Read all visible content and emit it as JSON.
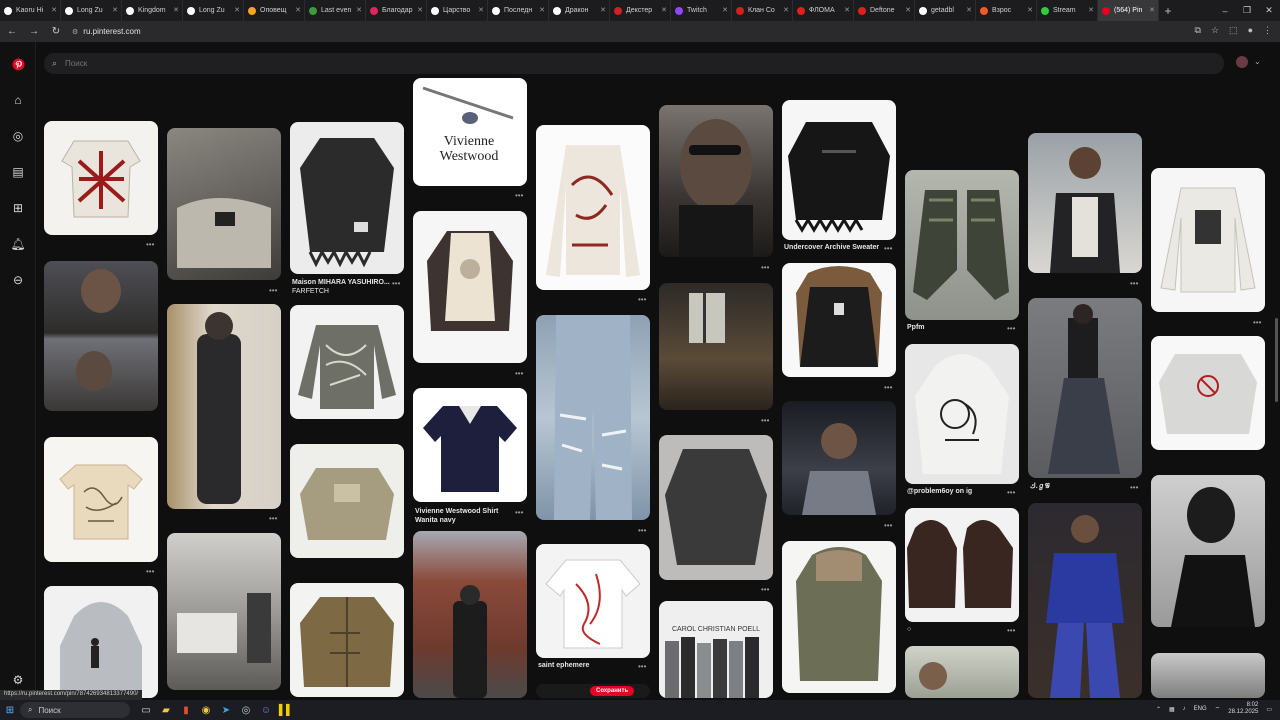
{
  "browser": {
    "tabs": [
      {
        "label": "Kaoru Hi",
        "color": "#ffffff"
      },
      {
        "label": "Long Zu",
        "color": "#ffffff"
      },
      {
        "label": "Kingdom",
        "color": "#ffffff"
      },
      {
        "label": "Long Zu",
        "color": "#ffffff"
      },
      {
        "label": "Оповещ",
        "color": "#f4a523"
      },
      {
        "label": "Last even",
        "color": "#3d9b3d"
      },
      {
        "label": "Благодар",
        "color": "#e0245e"
      },
      {
        "label": "Царство",
        "color": "#ffffff"
      },
      {
        "label": "Последн",
        "color": "#ffffff"
      },
      {
        "label": "Дракон",
        "color": "#ffffff"
      },
      {
        "label": "Декстер",
        "color": "#cc2222"
      },
      {
        "label": "Twitch",
        "color": "#9146ff"
      },
      {
        "label": "Клан Со",
        "color": "#cc2222"
      },
      {
        "label": "ФЛОМА",
        "color": "#e02020"
      },
      {
        "label": "Deftone",
        "color": "#e02020"
      },
      {
        "label": "getadbl",
        "color": "#ffffff"
      },
      {
        "label": "Взрос",
        "color": "#f05a28"
      },
      {
        "label": "Stream",
        "color": "#2ecc40"
      },
      {
        "label": "(564) Pin",
        "color": "#e60023"
      }
    ],
    "active_tab_index": 18,
    "url": "ru.pinterest.com",
    "status_url": "https://ru.pinterest.com/pin/787426934813377490/"
  },
  "search": {
    "placeholder": "Поиск"
  },
  "pins": {
    "farfetch": {
      "line1": "Maison MIHARA YASUHIRO...",
      "line2": "FARFETCH"
    },
    "vivienne_shirt": {
      "line1": "Vivienne Westwood Shirt",
      "line2": "Wanita navy"
    },
    "saint": "saint ephemere",
    "undercover": "Undercover Archive Sweater",
    "ppfm": "Ppfm",
    "problem": "@problem6oy on ig",
    "cgd": "ك.ℊ𝒢",
    "circle": "○",
    "vivienne_logo": "Vivienne Westwood",
    "carol": "CAROL CHRISTIAN POELL",
    "save_button": "Сохранить"
  },
  "taskbar": {
    "search": "Поиск",
    "time": "8:02",
    "date": "28.12.2025",
    "lang": "ENG"
  },
  "colors": {
    "pinterest_red": "#e60023",
    "page_bg": "#0f0f10"
  }
}
